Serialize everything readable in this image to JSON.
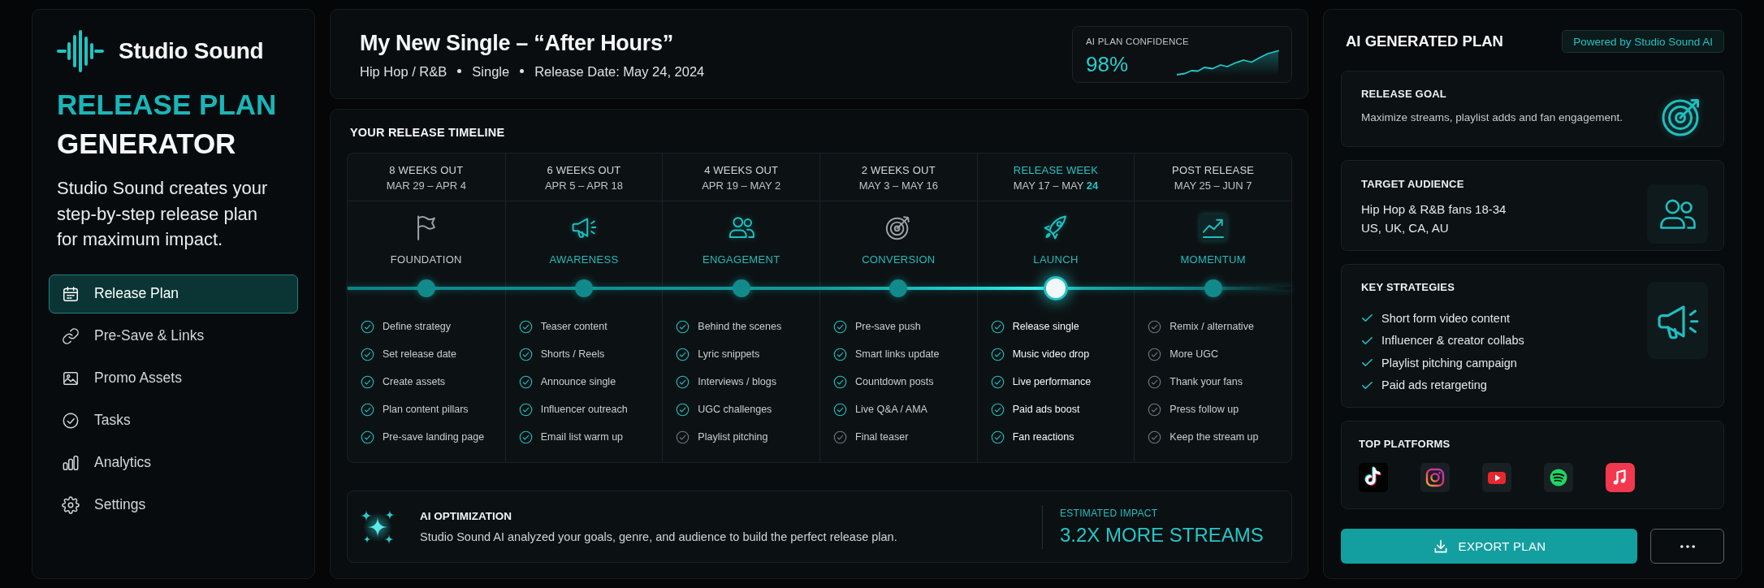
{
  "brand": {
    "name": "Studio Sound"
  },
  "sidebar": {
    "title_accent": "RELEASE PLAN",
    "title": "GENERATOR",
    "description": "Studio Sound creates your step-by-step release plan for maximum impact.",
    "items": [
      {
        "label": "Release Plan",
        "kind": "calendar",
        "selected": true
      },
      {
        "label": "Pre-Save & Links",
        "kind": "link",
        "selected": false
      },
      {
        "label": "Promo Assets",
        "kind": "image",
        "selected": false
      },
      {
        "label": "Tasks",
        "kind": "check",
        "selected": false
      },
      {
        "label": "Analytics",
        "kind": "chart",
        "selected": false
      },
      {
        "label": "Settings",
        "kind": "gear",
        "selected": false
      }
    ]
  },
  "header": {
    "title": "My New Single – “After Hours”",
    "meta": [
      "Hip Hop / R&B",
      "Single",
      "Release Date: May 24, 2024"
    ],
    "confidence": {
      "label": "AI PLAN CONFIDENCE",
      "value": "98%"
    }
  },
  "timeline": {
    "title": "YOUR RELEASE TIMELINE",
    "phases": [
      {
        "timing": "8 WEEKS OUT",
        "date": "MAR 29 – APR 4",
        "kind": "flag",
        "name": "FOUNDATION",
        "accent": false,
        "icon_accent": false,
        "selected": false,
        "tasks": [
          {
            "label": "Define strategy",
            "done": true
          },
          {
            "label": "Set release date",
            "done": true
          },
          {
            "label": "Create assets",
            "done": true
          },
          {
            "label": "Plan content pillars",
            "done": true
          },
          {
            "label": "Pre-save landing page",
            "done": true
          }
        ]
      },
      {
        "timing": "6 WEEKS OUT",
        "date": "APR 5 – APR 18",
        "kind": "megaphone",
        "name": "AWARENESS",
        "accent": true,
        "icon_accent": true,
        "selected": false,
        "tasks": [
          {
            "label": "Teaser content",
            "done": true
          },
          {
            "label": "Shorts / Reels",
            "done": true
          },
          {
            "label": "Announce single",
            "done": true
          },
          {
            "label": "Influencer outreach",
            "done": true
          },
          {
            "label": "Email list warm up",
            "done": true
          }
        ]
      },
      {
        "timing": "4 WEEKS OUT",
        "date": "APR 19 – MAY 2",
        "kind": "people",
        "name": "ENGAGEMENT",
        "accent": true,
        "icon_accent": true,
        "selected": false,
        "tasks": [
          {
            "label": "Behind the scenes",
            "done": true
          },
          {
            "label": "Lyric snippets",
            "done": true
          },
          {
            "label": "Interviews / blogs",
            "done": true
          },
          {
            "label": "UGC challenges",
            "done": true
          },
          {
            "label": "Playlist pitching",
            "done": false
          }
        ]
      },
      {
        "timing": "2 WEEKS OUT",
        "date": "MAY 3 – MAY 16",
        "kind": "target",
        "name": "CONVERSION",
        "accent": true,
        "icon_accent": false,
        "selected": false,
        "tasks": [
          {
            "label": "Pre-save push",
            "done": true
          },
          {
            "label": "Smart links update",
            "done": true
          },
          {
            "label": "Countdown posts",
            "done": true
          },
          {
            "label": "Live Q&A / AMA",
            "done": true
          },
          {
            "label": "Final teaser",
            "done": false
          }
        ]
      },
      {
        "timing": "RELEASE WEEK",
        "date": "MAY 17 – MAY **24**",
        "kind": "rocket",
        "name": "LAUNCH",
        "accent": true,
        "icon_accent": true,
        "selected": true,
        "tasks": [
          {
            "label": "Release single",
            "done": true
          },
          {
            "label": "Music video drop",
            "done": true
          },
          {
            "label": "Live performance",
            "done": true
          },
          {
            "label": "Paid ads boost",
            "done": true
          },
          {
            "label": "Fan reactions",
            "done": true
          }
        ]
      },
      {
        "timing": "POST RELEASE",
        "date": "MAY 25 – JUN 7",
        "kind": "trend",
        "name": "MOMENTUM",
        "accent": true,
        "icon_accent": true,
        "selected": false,
        "tasks": [
          {
            "label": "Remix / alternative",
            "done": false
          },
          {
            "label": "More UGC",
            "done": false
          },
          {
            "label": "Thank your fans",
            "done": false
          },
          {
            "label": "Press follow up",
            "done": false
          },
          {
            "label": "Keep the stream up",
            "done": false
          }
        ]
      }
    ]
  },
  "optimization": {
    "title": "AI OPTIMIZATION",
    "text": "Studio Sound AI analyzed your goals, genre, and audience to build the perfect release plan.",
    "impact_label": "ESTIMATED IMPACT",
    "impact_value": "3.2X MORE STREAMS"
  },
  "plan": {
    "title": "AI GENERATED PLAN",
    "badge": "Powered by Studio Sound AI",
    "release_goal": {
      "title": "RELEASE GOAL",
      "text": "Maximize streams, playlist adds and fan engagement."
    },
    "target_audience": {
      "title": "TARGET AUDIENCE",
      "lines": [
        "Hip Hop & R&B fans 18-34",
        "US, UK, CA, AU"
      ]
    },
    "key_strategies": {
      "title": "KEY STRATEGIES",
      "items": [
        "Short form video content",
        "Influencer & creator collabs",
        "Playlist pitching campaign",
        "Paid ads retargeting"
      ]
    },
    "top_platforms": {
      "title": "TOP PLATFORMS",
      "items": [
        {
          "kind": "note"
        },
        {
          "kind": "camera"
        },
        {
          "kind": "play"
        },
        {
          "kind": "waves"
        },
        {
          "kind": "music"
        }
      ]
    },
    "export_label": "EXPORT PLAN"
  }
}
